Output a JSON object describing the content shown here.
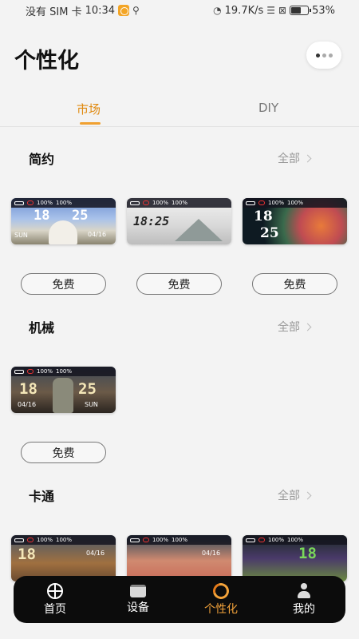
{
  "status_bar": {
    "carrier": "没有 SIM 卡",
    "time": "10:34",
    "net_speed": "19.7K/s",
    "battery": "53%",
    "battery_level": 0.53
  },
  "header": {
    "title": "个性化"
  },
  "tabs": [
    {
      "label": "市场",
      "active": true
    },
    {
      "label": "DIY",
      "active": false
    }
  ],
  "sections": [
    {
      "title": "简约",
      "all_label": "全部",
      "faces": [
        {
          "time_h": "18",
          "time_m": "25",
          "day": "SUN",
          "date": "04/16",
          "free_label": "免费"
        },
        {
          "time": "18:25",
          "free_label": "免费"
        },
        {
          "time_h": "18",
          "time_m": "25",
          "free_label": "免费"
        }
      ]
    },
    {
      "title": "机械",
      "all_label": "全部",
      "faces": [
        {
          "time_h": "18",
          "time_m": "25",
          "date": "04/16",
          "day": "SUN",
          "free_label": "免费"
        }
      ]
    },
    {
      "title": "卡通",
      "all_label": "全部",
      "faces": [
        {
          "time_h": "18",
          "date": "04/16"
        },
        {
          "date": "04/16"
        },
        {
          "time_m": "18"
        }
      ]
    }
  ],
  "face_topbar": {
    "pct1": "100%",
    "pct2": "100%"
  },
  "bottom_nav": [
    {
      "label": "首页",
      "icon": "home-icon",
      "active": false
    },
    {
      "label": "设备",
      "icon": "device-icon",
      "active": false
    },
    {
      "label": "个性化",
      "icon": "personalize-icon",
      "active": true
    },
    {
      "label": "我的",
      "icon": "profile-icon",
      "active": false
    }
  ],
  "colors": {
    "accent": "#e08a10",
    "nav_bg": "#0c0c0c",
    "page_bg": "#f3f3f3"
  }
}
